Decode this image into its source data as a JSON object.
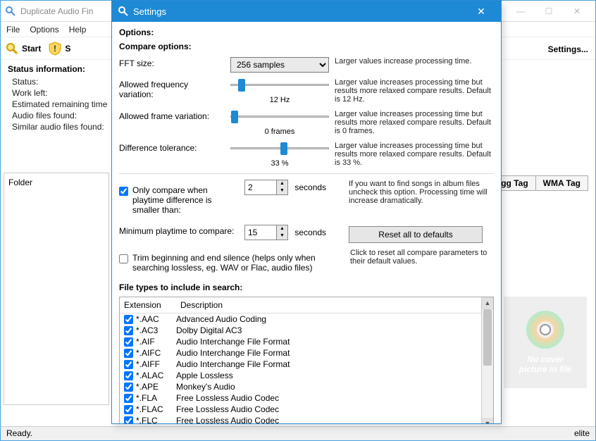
{
  "main": {
    "title": "Duplicate Audio Fin",
    "menu": {
      "file": "File",
      "options": "Options",
      "help": "Help"
    },
    "toolbar": {
      "start": "Start",
      "s": "S"
    },
    "settings_link": "Settings...",
    "status_info": {
      "heading": "Status information:",
      "status": "Status:",
      "work_left": "Work left:",
      "est": "Estimated remaining time",
      "found": "Audio files found:",
      "similar": "Similar audio files found:"
    },
    "folder_label": "Folder",
    "tags": {
      "ogg": "Ogg Tag",
      "wma": "WMA Tag"
    },
    "cover": {
      "line1": "No cover",
      "line2": "picture in file"
    },
    "status_bar": {
      "left": "Ready.",
      "right": "elite"
    }
  },
  "dlg": {
    "title": "Settings",
    "options_h": "Options:",
    "compare_h": "Compare options:",
    "fft": {
      "label": "FFT size:",
      "value": "256 samples",
      "help": "Larger values increase processing time."
    },
    "freq": {
      "label": "Allowed frequency variation:",
      "value": "12 Hz",
      "help": "Larger value increases processing time but results more relaxed compare results. Default is 12 Hz."
    },
    "frame": {
      "label": "Allowed frame variation:",
      "value": "0 frames",
      "help": "Larger value increases processing time but results more relaxed compare results. Default is 0 frames."
    },
    "diff": {
      "label": "Difference tolerance:",
      "value": "33 %",
      "help": "Larger value increases processing time but results more relaxed compare results. Default is 33 %."
    },
    "only_compare": {
      "label": "Only compare when playtime difference is smaller than:",
      "value": "2",
      "unit": "seconds",
      "help": "If you want to find songs in album files uncheck this option. Processing time will increase dramatically."
    },
    "min_play": {
      "label": "Minimum playtime to compare:",
      "value": "15",
      "unit": "seconds"
    },
    "reset": {
      "label": "Reset all to defaults",
      "help": "Click to reset all compare parameters to their default values."
    },
    "trim": {
      "label": "Trim beginning and end silence (helps only when searching lossless, eg. WAV or Flac, audio files)"
    },
    "ft_heading": "File types to include in search:",
    "ft_cols": {
      "ext": "Extension",
      "desc": "Description"
    },
    "file_types": [
      {
        "ext": "*.AAC",
        "desc": "Advanced Audio Coding"
      },
      {
        "ext": "*.AC3",
        "desc": "Dolby Digital AC3"
      },
      {
        "ext": "*.AIF",
        "desc": "Audio Interchange File Format"
      },
      {
        "ext": "*.AIFC",
        "desc": "Audio Interchange File Format"
      },
      {
        "ext": "*.AIFF",
        "desc": "Audio Interchange File Format"
      },
      {
        "ext": "*.ALAC",
        "desc": "Apple Lossless"
      },
      {
        "ext": "*.APE",
        "desc": "Monkey's Audio"
      },
      {
        "ext": "*.FLA",
        "desc": "Free Lossless Audio Codec"
      },
      {
        "ext": "*.FLAC",
        "desc": "Free Lossless Audio Codec"
      },
      {
        "ext": "*.FLC",
        "desc": "Free Lossless Audio Codec"
      }
    ]
  }
}
